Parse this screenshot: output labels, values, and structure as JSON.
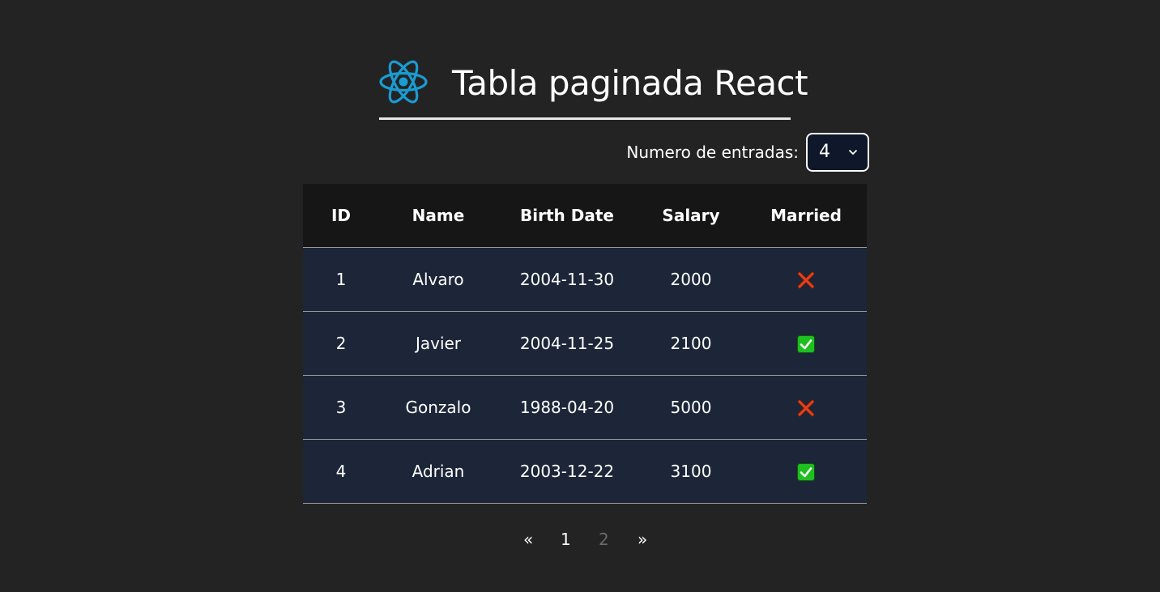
{
  "header": {
    "title": "Tabla paginada React",
    "logo_icon": "react-logo-icon",
    "logo_color": "#1a9bd1"
  },
  "entries": {
    "label": "Numero de entradas:",
    "selected": "4"
  },
  "table": {
    "headers": [
      "ID",
      "Name",
      "Birth Date",
      "Salary",
      "Married"
    ],
    "rows": [
      {
        "id": "1",
        "name": "Alvaro",
        "birth_date": "2004-11-30",
        "salary": "2000",
        "married": false
      },
      {
        "id": "2",
        "name": "Javier",
        "birth_date": "2004-11-25",
        "salary": "2100",
        "married": true
      },
      {
        "id": "3",
        "name": "Gonzalo",
        "birth_date": "1988-04-20",
        "salary": "5000",
        "married": false
      },
      {
        "id": "4",
        "name": "Adrian",
        "birth_date": "2003-12-22",
        "salary": "3100",
        "married": true
      }
    ],
    "married_true_icon": "check-mark-icon",
    "married_false_icon": "cross-mark-icon",
    "check_color": "#1fbf1f",
    "cross_color": "#e0401e"
  },
  "pagination": {
    "prev": "«",
    "pages": [
      "1",
      "2"
    ],
    "current_page": "1",
    "next": "»"
  },
  "colors": {
    "background": "#232323",
    "header_row": "#161616",
    "body_row": "#1c2638",
    "select_bg": "#0f172a"
  }
}
